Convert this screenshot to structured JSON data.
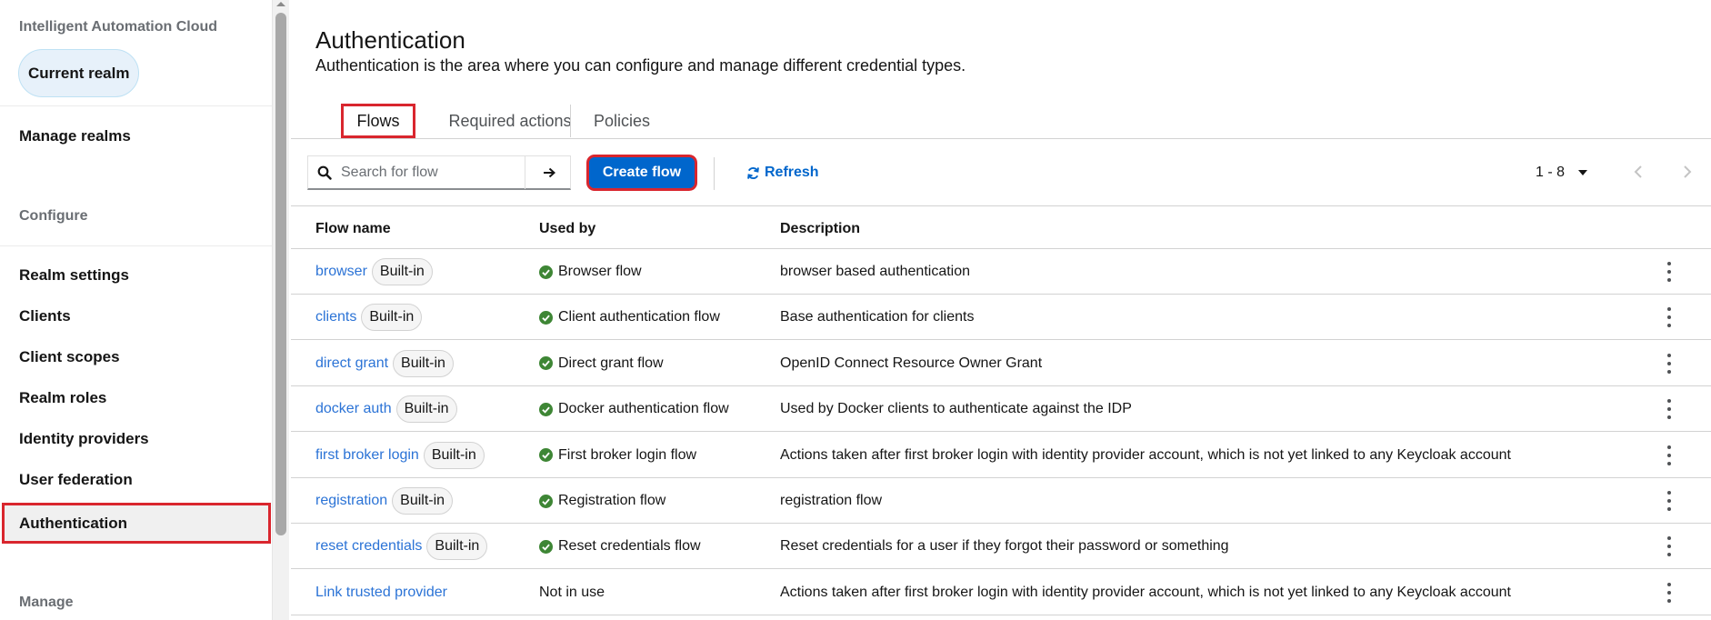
{
  "sidebar": {
    "app_name": "Intelligent Automation Cloud",
    "realm_button": "Current realm",
    "manage_realms": "Manage realms",
    "configure_heading": "Configure",
    "items": [
      {
        "label": "Realm settings"
      },
      {
        "label": "Clients"
      },
      {
        "label": "Client scopes"
      },
      {
        "label": "Realm roles"
      },
      {
        "label": "Identity providers"
      },
      {
        "label": "User federation"
      },
      {
        "label": "Authentication"
      }
    ],
    "manage_heading": "Manage"
  },
  "page": {
    "title": "Authentication",
    "description": "Authentication is the area where you can configure and manage different credential types."
  },
  "tabs": [
    {
      "label": "Flows",
      "active": true
    },
    {
      "label": "Required actions",
      "active": false
    },
    {
      "label": "Policies",
      "active": false
    }
  ],
  "toolbar": {
    "search_placeholder": "Search for flow",
    "create_label": "Create flow",
    "refresh_label": "Refresh",
    "pagination": "1 - 8"
  },
  "table": {
    "headers": [
      "Flow name",
      "Used by",
      "Description"
    ],
    "rows": [
      {
        "name": "browser",
        "badge": "Built-in",
        "used_by": "Browser flow",
        "in_use": true,
        "description": "browser based authentication"
      },
      {
        "name": "clients",
        "badge": "Built-in",
        "used_by": "Client authentication flow",
        "in_use": true,
        "description": "Base authentication for clients"
      },
      {
        "name": "direct grant",
        "badge": "Built-in",
        "used_by": "Direct grant flow",
        "in_use": true,
        "description": "OpenID Connect Resource Owner Grant"
      },
      {
        "name": "docker auth",
        "badge": "Built-in",
        "used_by": "Docker authentication flow",
        "in_use": true,
        "description": "Used by Docker clients to authenticate against the IDP"
      },
      {
        "name": "first broker login",
        "badge": "Built-in",
        "used_by": "First broker login flow",
        "in_use": true,
        "description": "Actions taken after first broker login with identity provider account, which is not yet linked to any Keycloak account"
      },
      {
        "name": "registration",
        "badge": "Built-in",
        "used_by": "Registration flow",
        "in_use": true,
        "description": "registration flow"
      },
      {
        "name": "reset credentials",
        "badge": "Built-in",
        "used_by": "Reset credentials flow",
        "in_use": true,
        "description": "Reset credentials for a user if they forgot their password or something"
      },
      {
        "name": "Link trusted provider",
        "badge": "",
        "used_by": "Not in use",
        "in_use": false,
        "description": "Actions taken after first broker login with identity provider account, which is not yet linked to any Keycloak account"
      }
    ]
  },
  "colors": {
    "accent": "#0066cc",
    "link": "#2b73d6",
    "success": "#3e8635",
    "highlight": "#d9262e"
  }
}
